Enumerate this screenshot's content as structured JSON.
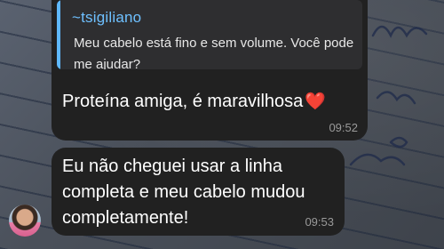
{
  "messages": [
    {
      "reply": {
        "author": "~tsigiliano",
        "text": "Meu cabelo está fino e sem volume. Você pode me ajudar?"
      },
      "text": "Proteína amiga, é maravilhosa",
      "emoji": "❤️",
      "time": "09:52"
    },
    {
      "text": "Eu não cheguei usar a linha\ncompleta e meu cabelo mudou\ncompletamente!",
      "time": "09:53"
    }
  ],
  "colors": {
    "bubble": "#212121",
    "reply_accent": "#5fb8ff",
    "timestamp": "#9a9a9a"
  },
  "icons": {
    "avatar": "user-avatar-photo"
  }
}
